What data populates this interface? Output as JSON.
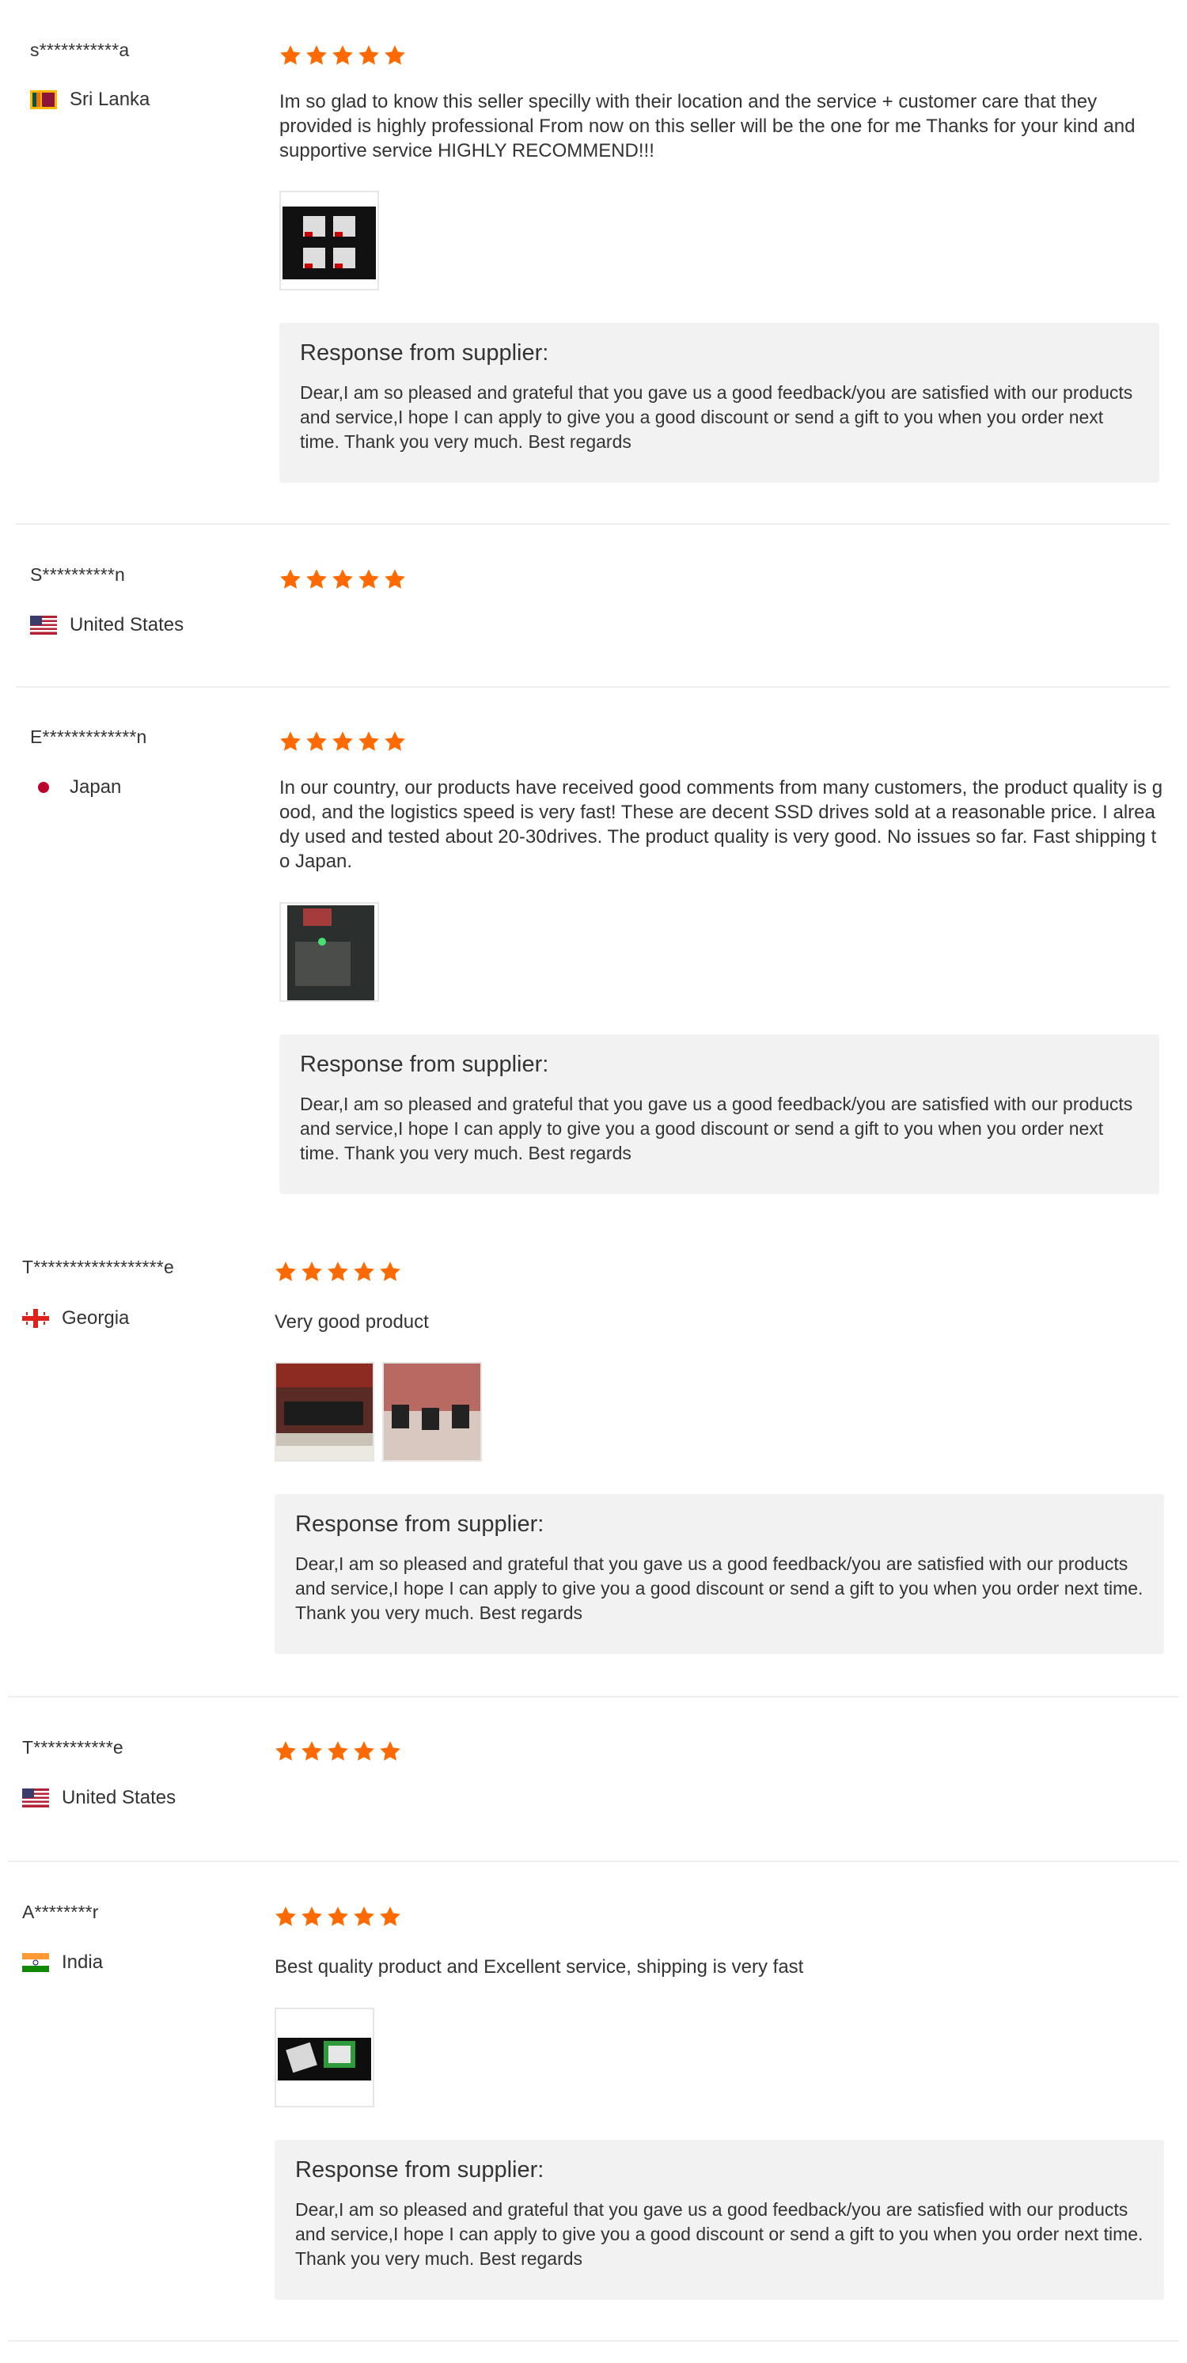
{
  "rating_max": 5,
  "star_color": "#ff6a00",
  "reviews": [
    {
      "name": "s***********a",
      "country": "Sri Lanka",
      "flag_icon": "sri-lanka-flag-icon",
      "rating": 5,
      "comment": "Im so glad to know this seller specilly with their location and the service + customer care that they provided is highly professional From now on this seller will be the one for me Thanks for your kind and supportive service HIGHLY RECOMMEND!!!",
      "photos": [
        "review-photo"
      ],
      "response_title": "Response from supplier:",
      "response_text": "Dear,I am so pleased and grateful that you gave us a good feedback/you are satisfied with our products and service,I hope I can apply to give you a good discount or send a gift to you when you order next time. Thank you very much. Best regards"
    },
    {
      "name": "S**********n",
      "country": "United States",
      "flag_icon": "us-flag-icon",
      "rating": 5
    },
    {
      "name": "E*************n",
      "country": "Japan",
      "flag_icon": "japan-flag-icon",
      "rating": 5,
      "comment": "In our country, our products have received good comments from many customers, the product quality is good, and the logistics speed is very fast! These are decent SSD drives sold at a reasonable price. I already used and tested about 20-30drives. The product quality is very good. No issues so far. Fast shipping to Japan.",
      "photos": [
        "review-photo"
      ],
      "response_title": "Response from supplier:",
      "response_text": "Dear,I am so pleased and grateful that you gave us a good feedback/you are satisfied with our products and service,I hope I can apply to give you a good discount or send a gift to you when you order next time. Thank you very much. Best regards"
    },
    {
      "name": "T******************e",
      "country": "Georgia",
      "flag_icon": "georgia-flag-icon",
      "rating": 5,
      "comment": "Very good product",
      "photos": [
        "review-photo",
        "review-photo"
      ],
      "response_title": "Response from supplier:",
      "response_text": "Dear,I am so pleased and grateful that you gave us a good feedback/you are satisfied with our products and service,I hope I can apply to give you a good discount or send a gift to you when you order next time. Thank you very much. Best regards"
    },
    {
      "name": "T***********e",
      "country": "United States",
      "flag_icon": "us-flag-icon",
      "rating": 5
    },
    {
      "name": "A********r",
      "country": "India",
      "flag_icon": "india-flag-icon",
      "rating": 5,
      "comment": "Best quality product and Excellent service, shipping is very fast",
      "photos": [
        "review-photo"
      ],
      "response_title": "Response from supplier:",
      "response_text": "Dear,I am so pleased and grateful that you gave us a good feedback/you are satisfied with our products and service,I hope I can apply to give you a good discount or send a gift to you when you order next time. Thank you very much. Best regards"
    }
  ]
}
